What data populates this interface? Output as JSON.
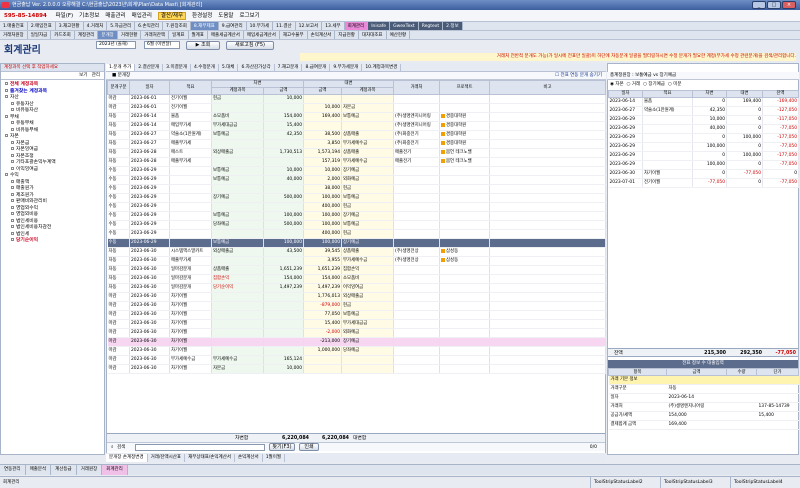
{
  "window": {
    "title": "현금출납 Ver. 2.0.0.0 오류해결 C:\\현금출납\\2023년\\회계\\Plan\\Data Mast\\ [회계관리]"
  },
  "menu": {
    "phone": "595-85-14894",
    "items": [
      "파일(F)",
      "기초정보",
      "매출관리",
      "매입관리",
      "결산/재무",
      "환경설정",
      "도움말",
      "로그보기"
    ],
    "highlight_index": 4
  },
  "toolbar1": [
    "1.매출전표",
    "2.매입전표",
    "3.재고현황",
    "4.거래처",
    "5.자금관리",
    "6.손익관리",
    "7.원장조회",
    "8.재무제표",
    "9.급여관리",
    "10.부가세",
    "11.결산",
    "12.보고서",
    "13.세무",
    "회계관리",
    "Inisafe",
    "GwexText",
    "Regtext",
    "2.정보"
  ],
  "toolbar2": [
    "거래처원장",
    "일일자금",
    "카드조회",
    "계정관리",
    "분개장",
    "거래현황",
    "거래처잔액",
    "일계표",
    "월계표",
    "매출세금계산서",
    "매입세금계산서",
    "재고수불부",
    "손익계산서",
    "지급현황",
    "대차대조표",
    "예산현황"
  ],
  "header": {
    "app_title": "회계관리",
    "year_value": "2023년 (올해)",
    "month_value": "6월 (이번달)",
    "search_label": "조회",
    "refresh_label": "새로고침 (F5)"
  },
  "notice": "거래처 전반적 분개도 가능(가 일시에 전표만 일괄)미 하단에 자동분개 일괄을 필터링하시면 수정 분개가 필요한 계정(부가세 수정 관련분개)을 검색/관리합니다.",
  "left": {
    "header": "계정과목 선택 후 작업하세요",
    "tabs": [
      "보기",
      "관리"
    ],
    "tree": [
      {
        "label": "전체 계정과목",
        "level": 1,
        "style": "red"
      },
      {
        "label": "즐겨찾는 계정과목",
        "level": 1,
        "style": "blue"
      },
      {
        "label": "자산",
        "level": 1,
        "style": ""
      },
      {
        "label": "유동자산",
        "level": 2,
        "style": ""
      },
      {
        "label": "비유동자산",
        "level": 2,
        "style": ""
      },
      {
        "label": "부채",
        "level": 1,
        "style": ""
      },
      {
        "label": "유동부채",
        "level": 2,
        "style": ""
      },
      {
        "label": "비유동부채",
        "level": 2,
        "style": ""
      },
      {
        "label": "자본",
        "level": 1,
        "style": ""
      },
      {
        "label": "자본금",
        "level": 2,
        "style": ""
      },
      {
        "label": "자본잉여금",
        "level": 2,
        "style": ""
      },
      {
        "label": "자본조정",
        "level": 2,
        "style": ""
      },
      {
        "label": "기타포괄손익누계액",
        "level": 2,
        "style": ""
      },
      {
        "label": "이익잉여금",
        "level": 2,
        "style": ""
      },
      {
        "label": "수익",
        "level": 1,
        "style": ""
      },
      {
        "label": "매출액",
        "level": 2,
        "style": ""
      },
      {
        "label": "매출원가",
        "level": 2,
        "style": ""
      },
      {
        "label": "제조원가",
        "level": 2,
        "style": ""
      },
      {
        "label": "판매비와관리비",
        "level": 2,
        "style": ""
      },
      {
        "label": "영업외수익",
        "level": 2,
        "style": ""
      },
      {
        "label": "영업외비용",
        "level": 2,
        "style": ""
      },
      {
        "label": "법인세비용",
        "level": 2,
        "style": ""
      },
      {
        "label": "법인세비용차감전",
        "level": 2,
        "style": ""
      },
      {
        "label": "법인세",
        "level": 2,
        "style": ""
      },
      {
        "label": "당기순이익",
        "level": 2,
        "style": "red"
      }
    ]
  },
  "center": {
    "tabs": [
      "1.분개 추가",
      "2.결산분개",
      "3.미결분개",
      "4.수정분개",
      "5.대체",
      "6.자산감가상각",
      "7.재고분개",
      "8.급여분개",
      "9.부가세분개",
      "10.계정과목변경"
    ],
    "bar_label": "분개장",
    "bar_right": "전표 연동 분개 숨기기",
    "columns": [
      "분개구분",
      "일자",
      "적요",
      "계정과목",
      "금액",
      "금액",
      "계정과목",
      "거래처",
      "프로젝트",
      "비고"
    ],
    "group_debit": "차변",
    "group_credit": "대변",
    "rows": [
      {
        "t": "마감",
        "d": "2023-06-01",
        "memo": "전기이월",
        "dacc": "현금",
        "damt": "10,000",
        "camt": "",
        "cacc": "",
        "vendor": "",
        "proj": "",
        "style": ""
      },
      {
        "t": "마감",
        "d": "2023-06-01",
        "memo": "전기이월",
        "dacc": "",
        "damt": "",
        "camt": "10,000",
        "cacc": "자본금",
        "vendor": "",
        "proj": "",
        "style": ""
      },
      {
        "t": "자동",
        "d": "2023-06-14",
        "memo": "물품",
        "dacc": "소모품비",
        "damt": "154,000",
        "camt": "169,400",
        "cacc": "보통예금",
        "vendor": "(주)생명엔지니어링",
        "proj": "경중대학원",
        "style": ""
      },
      {
        "t": "자동",
        "d": "2023-06-14",
        "memo": "매입부가세",
        "dacc": "부가세대급금",
        "damt": "15,400",
        "camt": "",
        "cacc": "",
        "vendor": "(주)생명엔지니어링",
        "proj": "경중대학원",
        "style": ""
      },
      {
        "t": "자동",
        "d": "2023-06-27",
        "memo": "약술소(1만원계)",
        "dacc": "보통예금",
        "damt": "42,350",
        "camt": "38,500",
        "cacc": "상품매출",
        "vendor": "(주)화중전기",
        "proj": "경중대학원",
        "style": ""
      },
      {
        "t": "자동",
        "d": "2023-06-27",
        "memo": "매출부가세",
        "dacc": "",
        "damt": "",
        "camt": "3,850",
        "cacc": "부가세예수금",
        "vendor": "(주)화중전기",
        "proj": "경중대학원",
        "style": ""
      },
      {
        "t": "자동",
        "d": "2023-06-28",
        "memo": "매스트",
        "dacc": "외상매출금",
        "damt": "1,730,513",
        "camt": "1,573,194",
        "cacc": "상품매출",
        "vendor": "매출전기",
        "proj": "봄언 테크노밸",
        "style": ""
      },
      {
        "t": "자동",
        "d": "2023-06-28",
        "memo": "매출부가세",
        "dacc": "",
        "damt": "",
        "camt": "157,319",
        "cacc": "부가세예수금",
        "vendor": "매출전기",
        "proj": "봄언 테크노밸",
        "style": ""
      },
      {
        "t": "수동",
        "d": "2023-06-29",
        "memo": "",
        "dacc": "보통예금",
        "damt": "10,000",
        "camt": "10,000",
        "cacc": "장기예금",
        "vendor": "",
        "proj": "",
        "style": ""
      },
      {
        "t": "수동",
        "d": "2023-06-29",
        "memo": "",
        "dacc": "보통예금",
        "damt": "40,000",
        "camt": "2,000",
        "cacc": "외화예금",
        "vendor": "",
        "proj": "",
        "style": ""
      },
      {
        "t": "수동",
        "d": "2023-06-29",
        "memo": "",
        "dacc": "",
        "damt": "",
        "camt": "38,000",
        "cacc": "현금",
        "vendor": "",
        "proj": "",
        "style": ""
      },
      {
        "t": "수동",
        "d": "2023-06-29",
        "memo": "",
        "dacc": "장기예금",
        "damt": "500,000",
        "camt": "100,000",
        "cacc": "보통예금",
        "vendor": "",
        "proj": "",
        "style": ""
      },
      {
        "t": "수동",
        "d": "2023-06-29",
        "memo": "",
        "dacc": "",
        "damt": "",
        "camt": "400,000",
        "cacc": "현금",
        "vendor": "",
        "proj": "",
        "style": ""
      },
      {
        "t": "수동",
        "d": "2023-06-29",
        "memo": "",
        "dacc": "보통예금",
        "damt": "100,000",
        "camt": "100,000",
        "cacc": "장기예금",
        "vendor": "",
        "proj": "",
        "style": ""
      },
      {
        "t": "수동",
        "d": "2023-06-29",
        "memo": "",
        "dacc": "당좌예금",
        "damt": "500,000",
        "camt": "100,000",
        "cacc": "보통예금",
        "vendor": "",
        "proj": "",
        "style": ""
      },
      {
        "t": "수동",
        "d": "2023-06-29",
        "memo": "",
        "dacc": "",
        "damt": "",
        "camt": "400,000",
        "cacc": "현금",
        "vendor": "",
        "proj": "",
        "style": ""
      },
      {
        "t": "수동",
        "d": "2023-06-29",
        "memo": "",
        "dacc": "보통예금",
        "damt": "100,000",
        "camt": "100,000",
        "cacc": "장기예금",
        "vendor": "",
        "proj": "",
        "style": "sel"
      },
      {
        "t": "자동",
        "d": "2023-06-30",
        "memo": "시스템액스말카트",
        "dacc": "외상매출금",
        "damt": "43,500",
        "camt": "39,545",
        "cacc": "상품매출",
        "vendor": "(주)생명전상",
        "proj": "삼성동",
        "style": "sep"
      },
      {
        "t": "자동",
        "d": "2023-06-30",
        "memo": "매출부가세",
        "dacc": "",
        "damt": "",
        "camt": "3,955",
        "cacc": "부가세예수금",
        "vendor": "(주)생명전상",
        "proj": "삼성동",
        "style": ""
      },
      {
        "t": "자동",
        "d": "2023-06-30",
        "memo": "일마감분개",
        "dacc": "상품매출",
        "damt": "1,651,239",
        "camt": "1,651,239",
        "cacc": "집합손익",
        "vendor": "",
        "proj": "",
        "style": ""
      },
      {
        "t": "자동",
        "d": "2023-06-30",
        "memo": "일마감분개",
        "dacc": "집합손익",
        "damt": "154,000",
        "camt": "154,000",
        "cacc": "소모품비",
        "vendor": "",
        "proj": "",
        "style": "rdl"
      },
      {
        "t": "자동",
        "d": "2023-06-30",
        "memo": "일마감분개",
        "dacc": "당기순이익",
        "damt": "1,497,239",
        "camt": "1,497,239",
        "cacc": "이익잉여금",
        "vendor": "",
        "proj": "",
        "style": "rdl"
      },
      {
        "t": "마감",
        "d": "2023-06-30",
        "memo": "차기이월",
        "dacc": "",
        "damt": "",
        "camt": "1,776,013",
        "cacc": "외상매출금",
        "vendor": "",
        "proj": "",
        "style": ""
      },
      {
        "t": "마감",
        "d": "2023-06-30",
        "memo": "차기이월",
        "dacc": "",
        "damt": "",
        "camt": "-879,000",
        "cacc": "현금",
        "vendor": "",
        "proj": "",
        "style": "rdc"
      },
      {
        "t": "마감",
        "d": "2023-06-30",
        "memo": "차기이월",
        "dacc": "",
        "damt": "",
        "camt": "77,050",
        "cacc": "보통예금",
        "vendor": "",
        "proj": "",
        "style": ""
      },
      {
        "t": "마감",
        "d": "2023-06-30",
        "memo": "차기이월",
        "dacc": "",
        "damt": "",
        "camt": "15,400",
        "cacc": "부가세대급금",
        "vendor": "",
        "proj": "",
        "style": ""
      },
      {
        "t": "마감",
        "d": "2023-06-30",
        "memo": "차기이월",
        "dacc": "",
        "damt": "",
        "camt": "-2,000",
        "cacc": "외화예금",
        "vendor": "",
        "proj": "",
        "style": "rdc"
      },
      {
        "t": "마감",
        "d": "2023-06-30",
        "memo": "차기이월",
        "dacc": "",
        "damt": "",
        "camt": "-213,000",
        "cacc": "장기예금",
        "vendor": "",
        "proj": "",
        "style": "pink"
      },
      {
        "t": "마감",
        "d": "2023-06-30",
        "memo": "차기이월",
        "dacc": "",
        "damt": "",
        "camt": "1,000,000",
        "cacc": "당좌예금",
        "vendor": "",
        "proj": "",
        "style": ""
      },
      {
        "t": "마감",
        "d": "2023-06-30",
        "memo": "부가세예수금",
        "dacc": "부가세예수금",
        "damt": "165,124",
        "camt": "",
        "cacc": "",
        "vendor": "",
        "proj": "",
        "style": ""
      },
      {
        "t": "마감",
        "d": "2023-06-30",
        "memo": "차기이월",
        "dacc": "자본금",
        "damt": "10,000",
        "camt": "",
        "cacc": "",
        "vendor": "",
        "proj": "",
        "style": ""
      }
    ],
    "total_label": "차변합",
    "total_debit": "6,220,084",
    "total_credit": "6,220,084",
    "total_right": "대변합",
    "search_label": "검색",
    "search_btn1": "찾기(F3)",
    "search_btn2": "인쇄",
    "page": "0/0",
    "bottom_tabs": [
      "분개장 손계정변경",
      "거래/잔액시산표",
      "재무상태표/손익계산서",
      "손익계산서",
      "1월이월"
    ]
  },
  "right": {
    "top": [
      "총계정원장",
      "보통예금",
      "vs",
      "장기예금"
    ],
    "sel": [
      "자본",
      "거래",
      "장기예금",
      "미분"
    ],
    "columns": [
      "일자",
      "적요",
      "차변",
      "대변",
      "잔액"
    ],
    "rows": [
      {
        "d": "2023-06-14",
        "m": "물품",
        "dr": "0",
        "cr": "169,400",
        "b": "-169,400",
        "neg": true
      },
      {
        "d": "2023-06-27",
        "m": "약술소(1만원계)",
        "dr": "42,350",
        "cr": "0",
        "b": "-127,050",
        "neg": true
      },
      {
        "d": "2023-06-29",
        "m": "",
        "dr": "10,000",
        "cr": "0",
        "b": "-117,050",
        "neg": true
      },
      {
        "d": "2023-06-29",
        "m": "",
        "dr": "40,000",
        "cr": "0",
        "b": "-77,050",
        "neg": true
      },
      {
        "d": "2023-06-29",
        "m": "",
        "dr": "0",
        "cr": "100,000",
        "b": "-177,050",
        "neg": true
      },
      {
        "d": "2023-06-29",
        "m": "",
        "dr": "100,000",
        "cr": "0",
        "b": "-77,050",
        "neg": true
      },
      {
        "d": "2023-06-29",
        "m": "",
        "dr": "0",
        "cr": "100,000",
        "b": "-177,050",
        "neg": true
      },
      {
        "d": "2023-06-29",
        "m": "",
        "dr": "100,000",
        "cr": "0",
        "b": "-77,050",
        "neg": true
      },
      {
        "d": "2023-06-30",
        "m": "차기이월",
        "dr": "0",
        "cr": "-77,050",
        "b": "0",
        "neg": false
      },
      {
        "d": "2023-07-01",
        "m": "전기이월",
        "dr": "-77,050",
        "cr": "0",
        "b": "-77,050",
        "neg": true
      }
    ],
    "total_label": "잔액",
    "total_dr": "215,300",
    "total_cr": "292,350",
    "total_b": "-77,050",
    "detail_header": "전표 정보 수 대출입력",
    "detail_cols": [
      "항목",
      "금액",
      "수량",
      "단가"
    ],
    "detail_rows": [
      {
        "k": "거래 기본 정보",
        "v": "",
        "q": "",
        "p": "",
        "yel": true
      },
      {
        "k": "거래구분",
        "v": "자동",
        "q": "",
        "p": "",
        "yel": false
      },
      {
        "k": "일자",
        "v": "2023-06-14",
        "q": "",
        "p": "",
        "yel": false
      },
      {
        "k": "거래처",
        "v": "(주)생명엔지니어링",
        "q": "",
        "p": "137-85-14739",
        "yel": false
      },
      {
        "k": "공급가/세액",
        "v": "154,000",
        "q": "",
        "p": "15,400",
        "yel": false
      },
      {
        "k": "결제합계 금액",
        "v": "169,400",
        "q": "",
        "p": "",
        "yel": false
      }
    ]
  },
  "status": {
    "tabs": [
      "연동관리",
      "매출분석",
      "계산등급",
      "거래원장",
      "회계관리"
    ],
    "active": 4,
    "bottom": [
      "회계관리",
      "ToolStripStatusLabel2",
      "ToolStripStatusLabel3",
      "ToolStripStatusLabel4"
    ]
  }
}
